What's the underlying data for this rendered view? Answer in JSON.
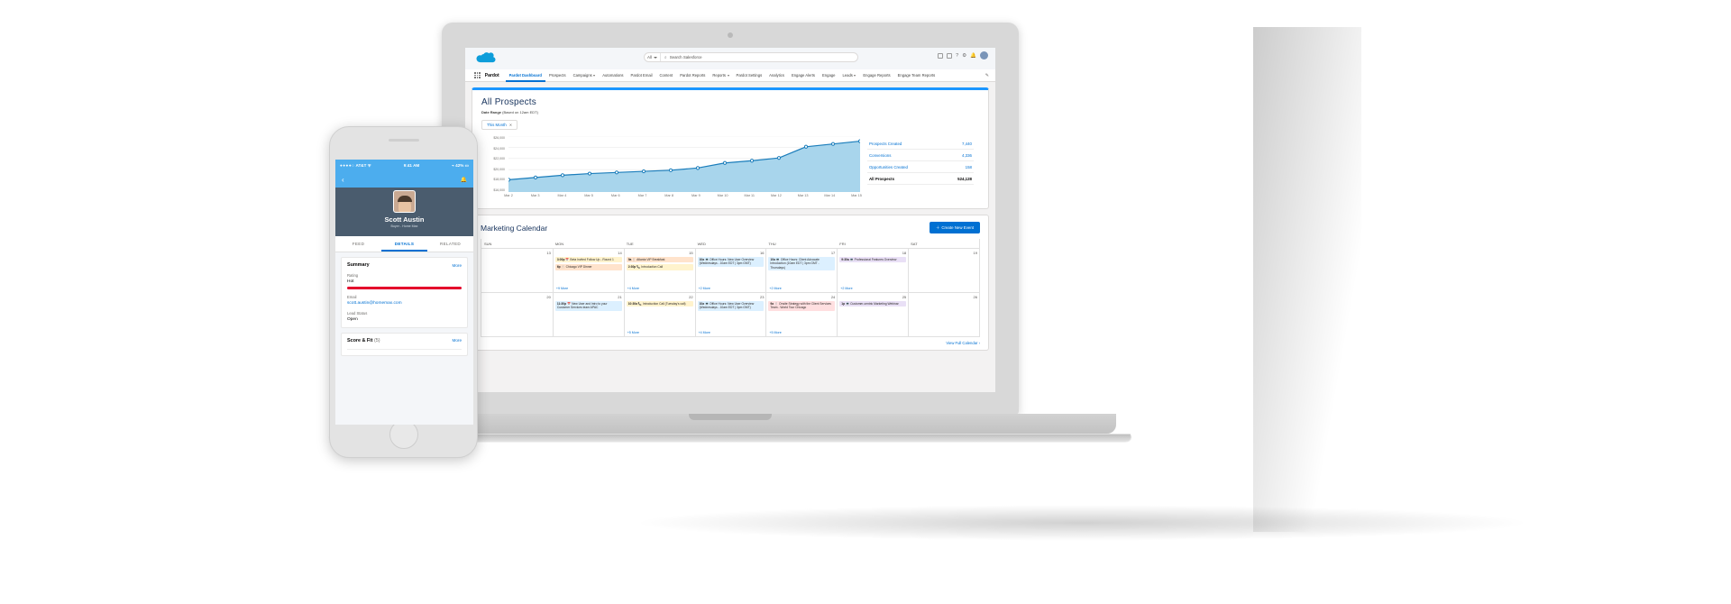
{
  "salesforce": {
    "search": {
      "scope": "All",
      "placeholder": "Search Salesforce",
      "search_icon": "search-icon"
    },
    "app_name": "Pardot",
    "nav": [
      {
        "label": "Pardot Dashboard",
        "active": true,
        "caret": false
      },
      {
        "label": "Prospects",
        "active": false,
        "caret": false
      },
      {
        "label": "Campaigns",
        "active": false,
        "caret": true
      },
      {
        "label": "Automations",
        "active": false,
        "caret": false
      },
      {
        "label": "Pardot Email",
        "active": false,
        "caret": false
      },
      {
        "label": "Content",
        "active": false,
        "caret": false
      },
      {
        "label": "Pardot Reports",
        "active": false,
        "caret": false
      },
      {
        "label": "Reports",
        "active": false,
        "caret": true
      },
      {
        "label": "Pardot Settings",
        "active": false,
        "caret": false
      },
      {
        "label": "Analytics",
        "active": false,
        "caret": false
      },
      {
        "label": "Engage Alerts",
        "active": false,
        "caret": false
      },
      {
        "label": "Engage",
        "active": false,
        "caret": false
      },
      {
        "label": "Leads",
        "active": false,
        "caret": true
      },
      {
        "label": "Engage Reports",
        "active": false,
        "caret": false
      },
      {
        "label": "Engage Team Reports",
        "active": false,
        "caret": false
      }
    ],
    "pencil_icon": "pencil-icon"
  },
  "prospects": {
    "title": "All Prospects",
    "date_range_label": "Date Range",
    "date_range_note": "(Based on 12am EDT)",
    "range_value": "This Month",
    "range_clear": "✕",
    "stats": [
      {
        "label": "Prospects Created",
        "value": "7,440",
        "total": false
      },
      {
        "label": "Conversions",
        "value": "4,336",
        "total": false
      },
      {
        "label": "Opportunities Created",
        "value": "158",
        "total": false
      },
      {
        "label": "All Prospects",
        "value": "524,128",
        "total": true
      }
    ]
  },
  "chart_data": {
    "type": "area",
    "title": "All Prospects",
    "xlabel": "",
    "ylabel": "",
    "grid": true,
    "legend": false,
    "ylim": [
      16000,
      26000
    ],
    "ytick_labels": [
      "$26,000",
      "$24,000",
      "$22,000",
      "$20,000",
      "$18,000",
      "$16,000"
    ],
    "ytick_values": [
      26000,
      24000,
      22000,
      20000,
      18000,
      16000
    ],
    "categories": [
      "Mar 2",
      "Mar 3",
      "Mar 4",
      "Mar 5",
      "Mar 6",
      "Mar 7",
      "Mar 8",
      "Mar 9",
      "Mar 10",
      "Mar 11",
      "Mar 12",
      "Mar 13",
      "Mar 14",
      "Mar 15"
    ],
    "series": [
      {
        "name": "All Prospects",
        "color": "#1b7dbb",
        "fill": "#a8d5ec",
        "values": [
          18200,
          18600,
          19000,
          19300,
          19500,
          19700,
          19900,
          20300,
          21200,
          21600,
          22100,
          24100,
          24600,
          25100
        ]
      }
    ]
  },
  "calendar": {
    "title": "Marketing Calendar",
    "create_label": "Create New Event",
    "create_icon": "plus-icon",
    "view_full": "View Full Calendar ›",
    "dow": [
      "SUN",
      "MON",
      "TUE",
      "WED",
      "THU",
      "FRI",
      "SAT"
    ],
    "weeks": [
      {
        "days": [
          {
            "num": "13",
            "events": [],
            "more": ""
          },
          {
            "num": "14",
            "events": [
              {
                "time": "3:00p",
                "icon": "📅",
                "text": "Beta Invited Follow Up - Round 1",
                "color": "yellow"
              },
              {
                "time": "6p",
                "icon": "🍴",
                "text": "Chicago VIP Dinner",
                "color": "orange"
              }
            ],
            "more": "+9 More"
          },
          {
            "num": "15",
            "events": [
              {
                "time": "9a",
                "icon": "🍴",
                "text": "Atlanta VIP Breakfast",
                "color": "orange"
              },
              {
                "time": "2:30p",
                "icon": "📞",
                "text": "Introduction Call",
                "color": "yellow"
              }
            ],
            "more": "+4 More"
          },
          {
            "num": "16",
            "events": [
              {
                "time": "10a",
                "icon": "💻",
                "text": "Office Hours: New User Overview (Wednesdays - 10am EDT | 3pm GMT)",
                "color": "blue"
              }
            ],
            "more": "+2 More"
          },
          {
            "num": "17",
            "events": [
              {
                "time": "10a",
                "icon": "💻",
                "text": "Office Hours: Client Advocate Introduction (10am EDT | 3pm GMT - Thursdays)",
                "color": "blue"
              }
            ],
            "more": "+2 More"
          },
          {
            "num": "18",
            "events": [
              {
                "time": "9:30a",
                "icon": "💻",
                "text": "Professional Features Overview",
                "color": "purple"
              }
            ],
            "more": "+2 More"
          },
          {
            "num": "19",
            "events": [],
            "more": ""
          }
        ]
      },
      {
        "days": [
          {
            "num": "20",
            "events": [],
            "more": ""
          },
          {
            "num": "21",
            "events": [
              {
                "time": "11:30p",
                "icon": "📅",
                "text": "New User and Intro to your Customer Services team APAC",
                "color": "blue"
              }
            ],
            "more": ""
          },
          {
            "num": "22",
            "events": [
              {
                "time": "10:30a",
                "icon": "📞",
                "text": "Introduction Call (Tuesday's call)",
                "color": "yellow"
              }
            ],
            "more": "+5 More"
          },
          {
            "num": "23",
            "events": [
              {
                "time": "10a",
                "icon": "💻",
                "text": "Office Hours: New User Overview (Wednesdays - 10am EDT | 3pm GMT)",
                "color": "blue"
              }
            ],
            "more": "+4 More"
          },
          {
            "num": "24",
            "events": [
              {
                "time": "9a",
                "icon": "🍴",
                "text": "Onsite Strategy with the Client Services Team - World Tour Chicago",
                "color": "pink"
              }
            ],
            "more": "+5 More"
          },
          {
            "num": "25",
            "events": [
              {
                "time": "1p",
                "icon": "💻",
                "text": "Customer-centric Marketing Webinar",
                "color": "purple"
              }
            ],
            "more": ""
          },
          {
            "num": "26",
            "events": [],
            "more": ""
          }
        ]
      }
    ]
  },
  "phone": {
    "status": {
      "dots": "●●●●○",
      "carrier": "AT&T",
      "wifi": "wifi-icon",
      "time": "9:41 AM",
      "bluetooth": "⌁",
      "battery": "42%"
    },
    "nav": {
      "back_icon": "back-arrow-icon",
      "bell_icon": "bell-icon"
    },
    "record": {
      "name": "Scott Austin",
      "subtitle": "Buyer - Home Max",
      "avatar": "avatar"
    },
    "tabs": [
      {
        "label": "FEED",
        "active": false
      },
      {
        "label": "DETAILS",
        "active": true
      },
      {
        "label": "RELATED",
        "active": false
      }
    ],
    "summary": {
      "header": "Summary",
      "more": "More",
      "fields": [
        {
          "label": "Rating",
          "value": "Hot",
          "bar": true,
          "link": false
        },
        {
          "label": "Email",
          "value": "scott.austin@homemax.com",
          "bar": false,
          "link": true
        },
        {
          "label": "Lead Status",
          "value": "Open",
          "bar": false,
          "link": false
        }
      ]
    },
    "score": {
      "header": "Score & Fit",
      "count": "(5)",
      "more": "More"
    }
  }
}
